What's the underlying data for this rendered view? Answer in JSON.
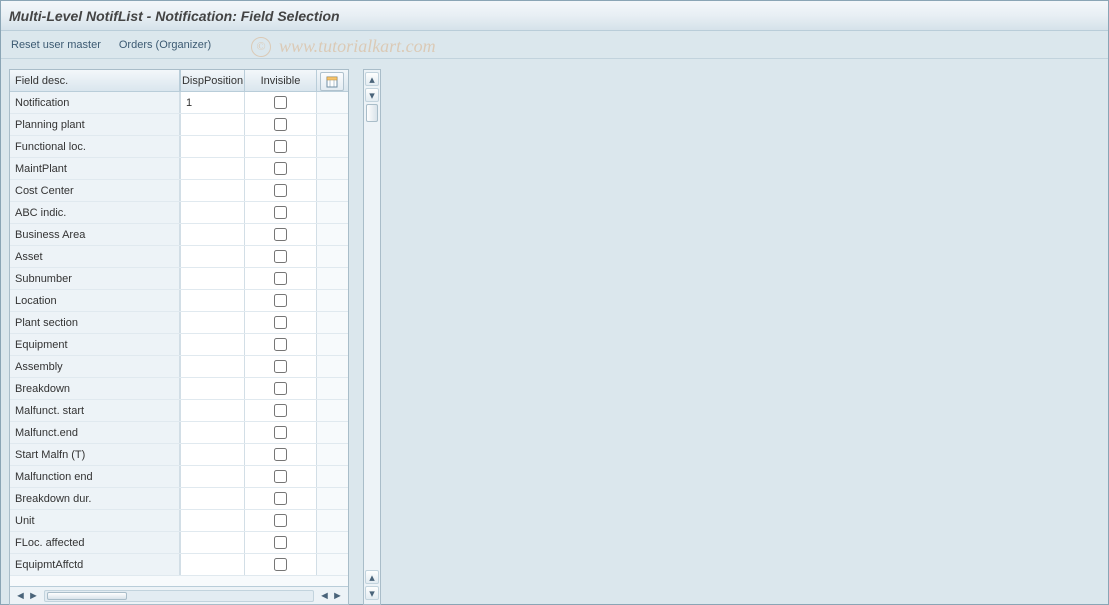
{
  "title": "Multi-Level NotifList - Notification: Field Selection",
  "toolbar": {
    "reset": "Reset user master",
    "orders": "Orders (Organizer)"
  },
  "watermark": "www.tutorialkart.com",
  "table": {
    "headers": {
      "desc": "Field desc.",
      "pos": "DispPosition",
      "inv": "Invisible"
    },
    "rows": [
      {
        "desc": "Notification",
        "pos": "1",
        "inv": false
      },
      {
        "desc": "Planning plant",
        "pos": "",
        "inv": false
      },
      {
        "desc": "Functional loc.",
        "pos": "",
        "inv": false
      },
      {
        "desc": "MaintPlant",
        "pos": "",
        "inv": false
      },
      {
        "desc": "Cost Center",
        "pos": "",
        "inv": false
      },
      {
        "desc": "ABC indic.",
        "pos": "",
        "inv": false
      },
      {
        "desc": "Business Area",
        "pos": "",
        "inv": false
      },
      {
        "desc": "Asset",
        "pos": "",
        "inv": false
      },
      {
        "desc": "Subnumber",
        "pos": "",
        "inv": false
      },
      {
        "desc": "Location",
        "pos": "",
        "inv": false
      },
      {
        "desc": "Plant section",
        "pos": "",
        "inv": false
      },
      {
        "desc": "Equipment",
        "pos": "",
        "inv": false
      },
      {
        "desc": "Assembly",
        "pos": "",
        "inv": false
      },
      {
        "desc": "Breakdown",
        "pos": "",
        "inv": false
      },
      {
        "desc": "Malfunct. start",
        "pos": "",
        "inv": false
      },
      {
        "desc": "Malfunct.end",
        "pos": "",
        "inv": false
      },
      {
        "desc": "Start Malfn (T)",
        "pos": "",
        "inv": false
      },
      {
        "desc": "Malfunction end",
        "pos": "",
        "inv": false
      },
      {
        "desc": "Breakdown dur.",
        "pos": "",
        "inv": false
      },
      {
        "desc": "Unit",
        "pos": "",
        "inv": false
      },
      {
        "desc": "FLoc. affected",
        "pos": "",
        "inv": false
      },
      {
        "desc": "EquipmtAffctd",
        "pos": "",
        "inv": false
      }
    ]
  }
}
